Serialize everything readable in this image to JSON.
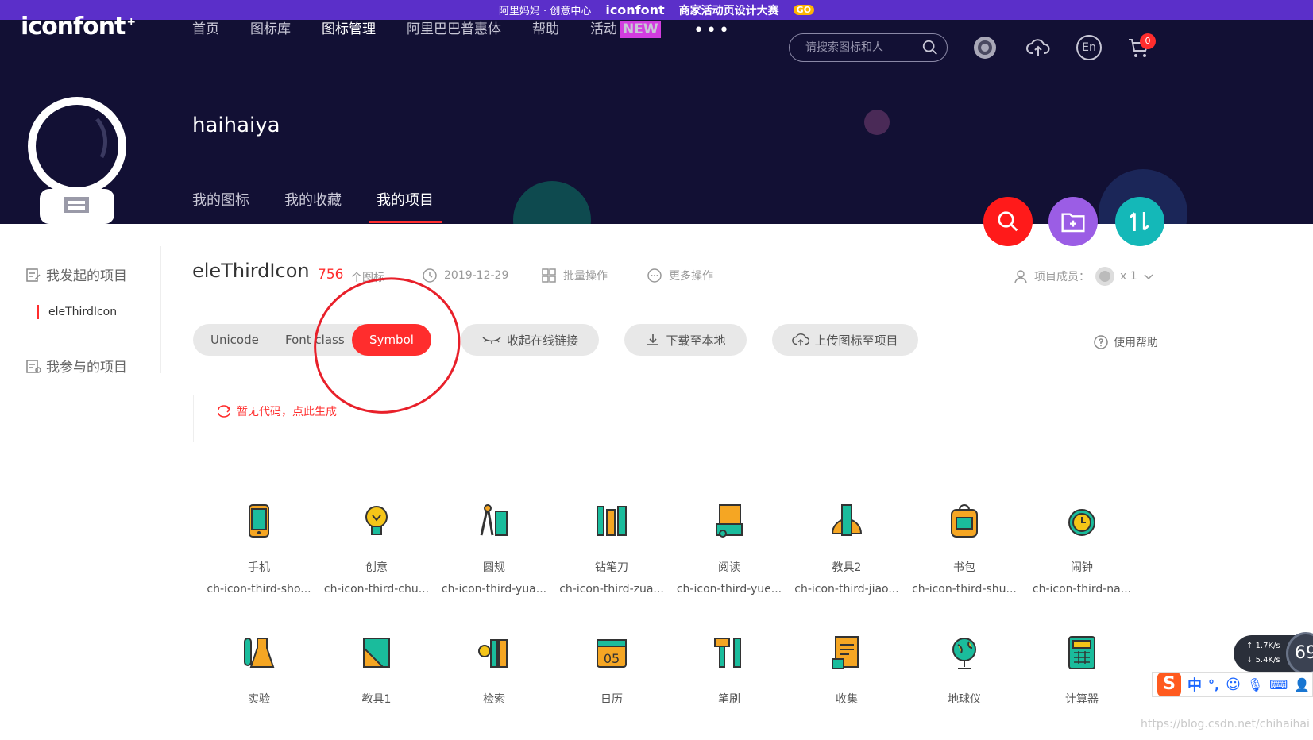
{
  "banner": {
    "alimama": "阿里妈妈 · 创意中心",
    "brand": "iconfont",
    "campaign": "商家活动页设计大赛",
    "go": "GO"
  },
  "nav": {
    "logo": "iconfont",
    "items": [
      {
        "label": "首页",
        "active": false
      },
      {
        "label": "图标库",
        "active": false
      },
      {
        "label": "图标管理",
        "active": true
      },
      {
        "label": "阿里巴巴普惠体",
        "active": false
      },
      {
        "label": "帮助",
        "active": false
      },
      {
        "label": "活动",
        "active": false
      }
    ],
    "new_badge": "NEW",
    "search_placeholder": "请搜索图标和人",
    "lang": "En",
    "cart_count": "0"
  },
  "profile": {
    "username": "haihaiya",
    "tabs": [
      {
        "label": "我的图标"
      },
      {
        "label": "我的收藏"
      },
      {
        "label": "我的项目"
      }
    ]
  },
  "sidebar": {
    "my_projects": "我发起的项目",
    "current_project": "eleThirdIcon",
    "joined_projects": "我参与的项目"
  },
  "project": {
    "name": "eleThirdIcon",
    "count": "756",
    "count_unit": "个图标",
    "date": "2019-12-29",
    "batch": "批量操作",
    "more": "更多操作",
    "members_label": "项目成员：",
    "members_count": "x 1",
    "modes": [
      "Unicode",
      "Font class",
      "Symbol"
    ],
    "collapse_link": "收起在线链接",
    "download": "下载至本地",
    "upload": "上传图标至项目",
    "help": "使用帮助",
    "no_code": "暂无代码，点此生成"
  },
  "icons": [
    {
      "name": "手机",
      "code": "ch-icon-third-sho...",
      "glyph": "phone-icon"
    },
    {
      "name": "创意",
      "code": "ch-icon-third-chu...",
      "glyph": "bulb-icon"
    },
    {
      "name": "圆规",
      "code": "ch-icon-third-yua...",
      "glyph": "compass-icon"
    },
    {
      "name": "钻笔刀",
      "code": "ch-icon-third-zua...",
      "glyph": "pencil-knife-icon"
    },
    {
      "name": "阅读",
      "code": "ch-icon-third-yue...",
      "glyph": "reading-icon"
    },
    {
      "name": "教具2",
      "code": "ch-icon-third-jiao...",
      "glyph": "protractor-icon"
    },
    {
      "name": "书包",
      "code": "ch-icon-third-shu...",
      "glyph": "backpack-icon"
    },
    {
      "name": "闹钟",
      "code": "ch-icon-third-na...",
      "glyph": "alarm-clock-icon"
    },
    {
      "name": "实验",
      "code": "",
      "glyph": "lab-icon"
    },
    {
      "name": "教具1",
      "code": "",
      "glyph": "triangle-ruler-icon"
    },
    {
      "name": "检索",
      "code": "",
      "glyph": "search-binders-icon"
    },
    {
      "name": "日历",
      "code": "",
      "glyph": "calendar-icon"
    },
    {
      "name": "笔刷",
      "code": "",
      "glyph": "brush-icon"
    },
    {
      "name": "收集",
      "code": "",
      "glyph": "collect-icon"
    },
    {
      "name": "地球仪",
      "code": "",
      "glyph": "globe-icon"
    },
    {
      "name": "计算器",
      "code": "",
      "glyph": "calculator-icon"
    }
  ],
  "calendar_day": "05",
  "net": {
    "up": "1.7K/s",
    "down": "5.4K/s",
    "pct": "69"
  },
  "ime": {
    "zh": "中"
  },
  "watermark": "https://blog.csdn.net/chihaihai",
  "colors": {
    "brand_red": "#ff2d2d",
    "hero_bg": "#121034",
    "banner_bg": "#5b2fc9",
    "fab_purple": "#9b5de5",
    "fab_teal": "#14b8b8"
  }
}
